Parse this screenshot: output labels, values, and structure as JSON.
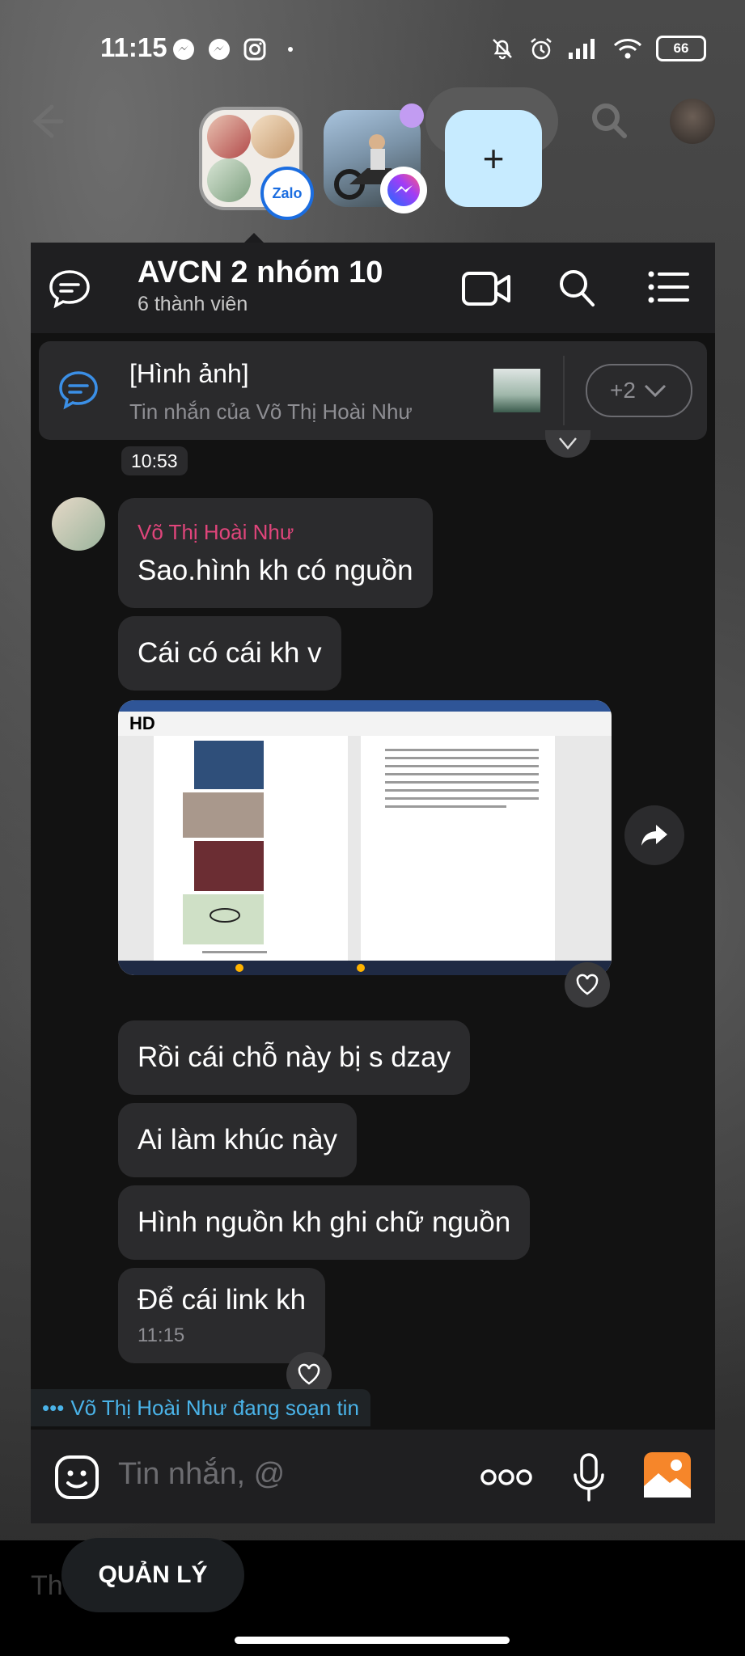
{
  "status_bar": {
    "time": "11:15",
    "battery": "66"
  },
  "chat_heads": {
    "zalo_badge": "Zalo",
    "add_label": "+"
  },
  "header": {
    "title": "AVCN 2 nhóm 10",
    "subtitle": "6 thành viên"
  },
  "pinned": {
    "title": "[Hình ảnh]",
    "subtitle": "Tin nhắn của Võ Thị Hoài Như",
    "more": "+2"
  },
  "messages": {
    "timestamp_top": "10:53",
    "sender_name": "Võ Thị Hoài Như",
    "m1": "Sao.hình kh có nguồn",
    "m2": "Cái có cái kh v",
    "image_badge": "HD",
    "m3": "Rồi cái chỗ này bị s dzay",
    "m4": "Ai làm khúc này",
    "m5": "Hình nguồn kh ghi chữ nguồn",
    "m6": "Để cái link kh",
    "m6_time": "11:15"
  },
  "typing": {
    "dots": "•••",
    "text": "Võ Thị Hoài Như đang soạn tin"
  },
  "composer": {
    "placeholder": "Tin nhắn, @"
  },
  "bottom": {
    "manage_label": "QUẢN LÝ",
    "ghost_text": "Th"
  },
  "colors": {
    "accent": "#4ab3e8",
    "sender_name": "#e0457b",
    "bubble": "#2b2b2d",
    "panel": "#121212"
  }
}
